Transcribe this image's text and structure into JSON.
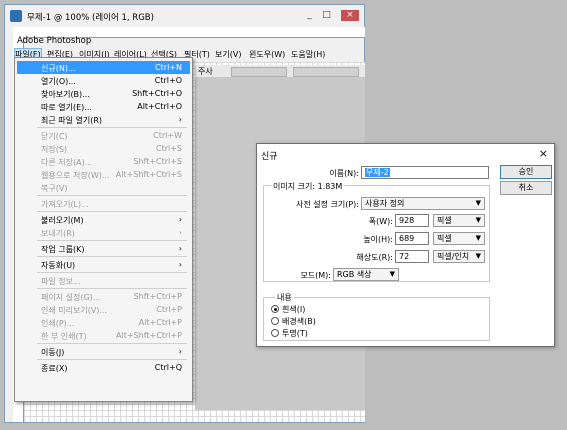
{
  "window": {
    "title": "무제-1 @ 100% (레이어 1, RGB)",
    "app_name": "Adobe Photoshop",
    "controls": [
      "_",
      "□",
      "×"
    ]
  },
  "menubar": [
    "파일(F)",
    "편집(E)",
    "이미지(I)",
    "레이어(L)",
    "선택(S)",
    "필터(T)",
    "보기(V)",
    "윈도우(W)",
    "도움말(H)"
  ],
  "options_bar": {
    "label": "주사"
  },
  "file_menu": [
    {
      "label": "신규(N)...",
      "shortcut": "Ctrl+N",
      "state": "highlight"
    },
    {
      "label": "열기(O)...",
      "shortcut": "Ctrl+O",
      "state": "normal"
    },
    {
      "label": "찾아보기(B)...",
      "shortcut": "Shft+Ctrl+O",
      "state": "normal"
    },
    {
      "label": "따로 열기(E)...",
      "shortcut": "Alt+Ctrl+O",
      "state": "normal"
    },
    {
      "label": "최근 파일 열기(R)",
      "shortcut": "›",
      "state": "normal"
    },
    {
      "sep": true
    },
    {
      "label": "닫기(C)",
      "shortcut": "Ctrl+W",
      "state": "disabled"
    },
    {
      "label": "저장(S)",
      "shortcut": "Ctrl+S",
      "state": "disabled"
    },
    {
      "label": "다른 저장(A)...",
      "shortcut": "Shft+Ctrl+S",
      "state": "disabled"
    },
    {
      "label": "웹용으로 저장(W)...",
      "shortcut": "Alt+Shft+Ctrl+S",
      "state": "disabled"
    },
    {
      "label": "복구(V)",
      "shortcut": "",
      "state": "disabled"
    },
    {
      "sep": true
    },
    {
      "label": "가져오기(L)...",
      "shortcut": "",
      "state": "disabled"
    },
    {
      "sep": true
    },
    {
      "label": "불러오기(M)",
      "shortcut": "›",
      "state": "normal"
    },
    {
      "label": "보내기(R)",
      "shortcut": "›",
      "state": "disabled"
    },
    {
      "sep": true
    },
    {
      "label": "작업 그룹(K)",
      "shortcut": "›",
      "state": "normal"
    },
    {
      "sep": true
    },
    {
      "label": "자동화(U)",
      "shortcut": "›",
      "state": "normal"
    },
    {
      "sep": true
    },
    {
      "label": "파일 정보...",
      "shortcut": "",
      "state": "disabled"
    },
    {
      "sep": true
    },
    {
      "label": "페이지 설정(G)...",
      "shortcut": "Shft+Ctrl+P",
      "state": "disabled"
    },
    {
      "label": "인쇄 미리보기(V)...",
      "shortcut": "Ctrl+P",
      "state": "disabled"
    },
    {
      "label": "인쇄(P)...",
      "shortcut": "Alt+Ctrl+P",
      "state": "disabled"
    },
    {
      "label": "한 부 인쇄(T)",
      "shortcut": "Alt+Shft+Ctrl+P",
      "state": "disabled"
    },
    {
      "sep": true
    },
    {
      "label": "이동(J)",
      "shortcut": "›",
      "state": "normal"
    },
    {
      "sep": true
    },
    {
      "label": "종료(X)",
      "shortcut": "Ctrl+Q",
      "state": "normal"
    }
  ],
  "dialog": {
    "title": "신규",
    "close": "×",
    "name_label": "이름(N):",
    "name_value": "무제-2",
    "image_size_label": "이미지 크기: 1.83M",
    "preset_label": "사전 설정 크기(P):",
    "preset_value": "사용자 정의",
    "width_label": "폭(W):",
    "width_value": "928",
    "width_unit": "픽셀",
    "height_label": "높이(H):",
    "height_value": "689",
    "height_unit": "픽셀",
    "resolution_label": "해상도(R):",
    "resolution_value": "72",
    "resolution_unit": "픽셀/인치",
    "mode_label": "모드(M):",
    "mode_value": "RGB 색상",
    "ok_label": "승인",
    "cancel_label": "취소",
    "contents_label": "내용",
    "contents_options": [
      "흰색(I)",
      "배경색(B)",
      "투명(T)"
    ],
    "contents_selected": 0
  }
}
